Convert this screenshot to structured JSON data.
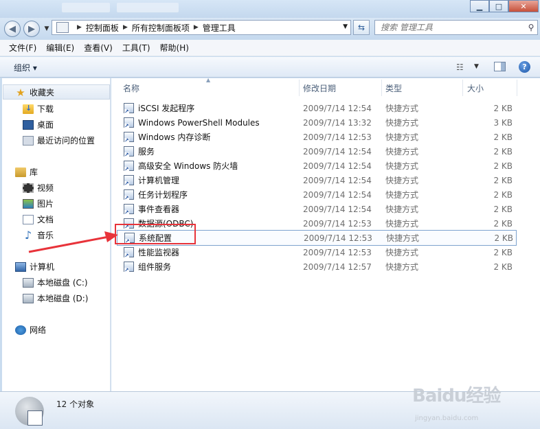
{
  "window": {
    "breadcrumb": [
      "控制面板",
      "所有控制面板项",
      "管理工具"
    ],
    "search_placeholder": "搜索 管理工具"
  },
  "menu": [
    "文件(F)",
    "编辑(E)",
    "查看(V)",
    "工具(T)",
    "帮助(H)"
  ],
  "toolbar": {
    "organize": "组织 ▾"
  },
  "nav": {
    "favorites": {
      "label": "收藏夹",
      "items": [
        "下载",
        "桌面",
        "最近访问的位置"
      ]
    },
    "libraries": {
      "label": "库",
      "items": [
        "视频",
        "图片",
        "文档",
        "音乐"
      ]
    },
    "computer": {
      "label": "计算机",
      "items": [
        "本地磁盘 (C:)",
        "本地磁盘 (D:)"
      ]
    },
    "network": {
      "label": "网络"
    }
  },
  "columns": {
    "name": "名称",
    "date": "修改日期",
    "type": "类型",
    "size": "大小"
  },
  "files": [
    {
      "name": "iSCSI 发起程序",
      "date": "2009/7/14 12:54",
      "type": "快捷方式",
      "size": "2 KB"
    },
    {
      "name": "Windows PowerShell Modules",
      "date": "2009/7/14 13:32",
      "type": "快捷方式",
      "size": "3 KB"
    },
    {
      "name": "Windows 内存诊断",
      "date": "2009/7/14 12:53",
      "type": "快捷方式",
      "size": "2 KB"
    },
    {
      "name": "服务",
      "date": "2009/7/14 12:54",
      "type": "快捷方式",
      "size": "2 KB"
    },
    {
      "name": "高级安全 Windows 防火墙",
      "date": "2009/7/14 12:54",
      "type": "快捷方式",
      "size": "2 KB"
    },
    {
      "name": "计算机管理",
      "date": "2009/7/14 12:54",
      "type": "快捷方式",
      "size": "2 KB"
    },
    {
      "name": "任务计划程序",
      "date": "2009/7/14 12:54",
      "type": "快捷方式",
      "size": "2 KB"
    },
    {
      "name": "事件查看器",
      "date": "2009/7/14 12:54",
      "type": "快捷方式",
      "size": "2 KB"
    },
    {
      "name": "数据源(ODBC)",
      "date": "2009/7/14 12:53",
      "type": "快捷方式",
      "size": "2 KB"
    },
    {
      "name": "系统配置",
      "date": "2009/7/14 12:53",
      "type": "快捷方式",
      "size": "2 KB",
      "selected": true
    },
    {
      "name": "性能监视器",
      "date": "2009/7/14 12:53",
      "type": "快捷方式",
      "size": "2 KB"
    },
    {
      "name": "组件服务",
      "date": "2009/7/14 12:57",
      "type": "快捷方式",
      "size": "2 KB"
    }
  ],
  "status": {
    "count": "12 个对象"
  },
  "watermark": {
    "brand": "Baidu经验",
    "url": "jingyan.baidu.com"
  },
  "colors": {
    "highlight_annotation": "#e8333a",
    "selection_border": "#7da2ce"
  }
}
